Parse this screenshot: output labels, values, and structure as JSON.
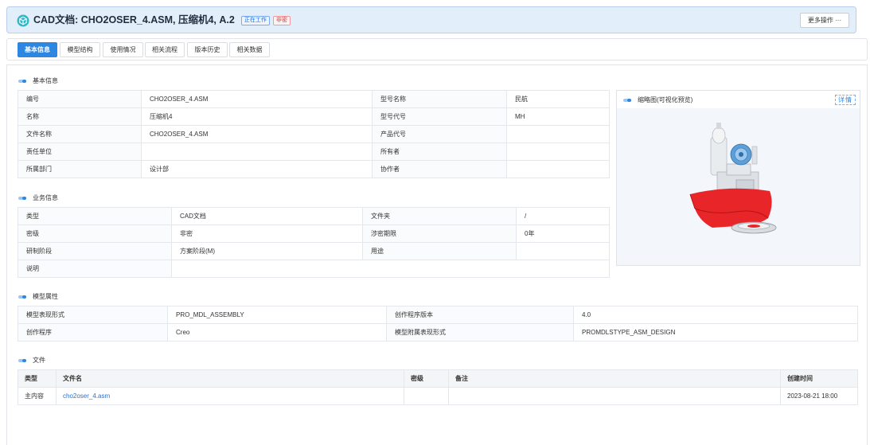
{
  "header": {
    "prefix": "CAD文档: ",
    "title": "CHO2OSER_4.ASM, 压缩机4, A.2",
    "badge_status": "正在工作",
    "badge_secret": "非密",
    "more_label": "更多操作 ···",
    "icon": "cube-icon"
  },
  "tabs": [
    "基本信息",
    "模型结构",
    "使用情况",
    "相关流程",
    "版本历史",
    "相关数据"
  ],
  "active_tab": 0,
  "basic": {
    "title": "基本信息",
    "rows": [
      [
        "编号",
        "CHO2OSER_4.ASM",
        "型号名称",
        "民航"
      ],
      [
        "名称",
        "压缩机4",
        "型号代号",
        "MH"
      ],
      [
        "文件名称",
        "CHO2OSER_4.ASM",
        "产品代号",
        ""
      ],
      [
        "责任单位",
        "",
        "所有者",
        ""
      ],
      [
        "所属部门",
        "设计部",
        "协作者",
        ""
      ]
    ]
  },
  "thumbnail": {
    "title": "缩略图(可视化预览)",
    "detail_label": "详情"
  },
  "business": {
    "title": "业务信息",
    "rows": [
      [
        "类型",
        "CAD文档",
        "文件夹",
        "/"
      ],
      [
        "密级",
        "非密",
        "涉密期限",
        "0年"
      ],
      [
        "研制阶段",
        "方案阶段(M)",
        "用途",
        ""
      ]
    ],
    "desc_label": "说明",
    "desc_value": ""
  },
  "model": {
    "title": "模型属性",
    "rows": [
      [
        "模型表现形式",
        "PRO_MDL_ASSEMBLY",
        "创作程序版本",
        "4.0"
      ],
      [
        "创作程序",
        "Creo",
        "模型附属表现形式",
        "PROMDLSTYPE_ASM_DESIGN"
      ]
    ]
  },
  "files": {
    "title": "文件",
    "columns": [
      "类型",
      "文件名",
      "密级",
      "备注",
      "创建时间"
    ],
    "rows": [
      [
        "主内容",
        "cho2oser_4.asm",
        "",
        "",
        "2023-08-21 18:00"
      ]
    ]
  },
  "colors": {
    "accent": "#2d86e0",
    "header_bg": "#e3eefb",
    "part_red": "#e8262a"
  }
}
